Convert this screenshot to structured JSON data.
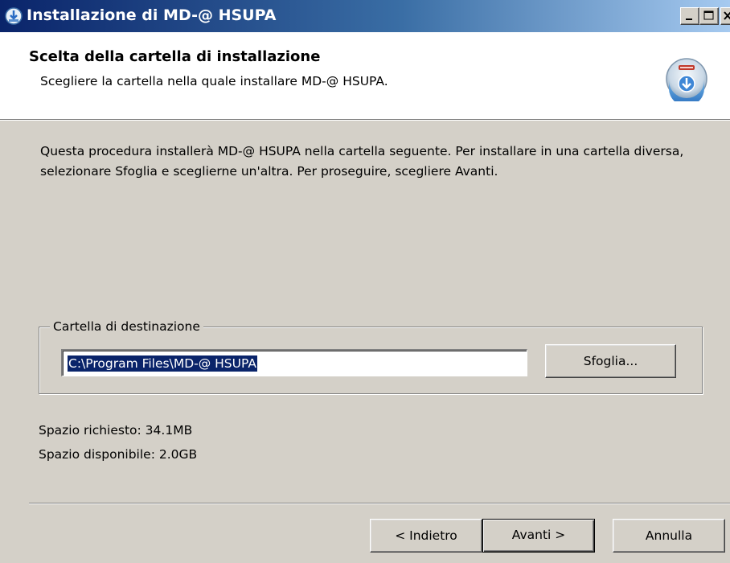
{
  "window": {
    "title": "Installazione di MD-@ HSUPA",
    "controls": {
      "minimize": "minimize",
      "maximize": "maximize",
      "close": "close"
    }
  },
  "header": {
    "title": "Scelta della cartella di installazione",
    "subtitle": "Scegliere la cartella nella quale installare MD-@ HSUPA.",
    "logo_icon": "installer-disc-icon"
  },
  "body": {
    "description": "Questa procedura installerà MD-@ HSUPA nella cartella seguente. Per installare in una cartella diversa, selezionare Sfoglia e sceglierne un'altra. Per proseguire, scegliere Avanti.",
    "destination": {
      "group_label": "Cartella di destinazione",
      "path_value": "C:\\Program Files\\MD-@ HSUPA",
      "browse_label": "Sfoglia..."
    },
    "space_required": "Spazio richiesto: 34.1MB",
    "space_available": "Spazio disponibile: 2.0GB"
  },
  "footer": {
    "back_label": "< Indietro",
    "next_label": "Avanti >",
    "cancel_label": "Annulla"
  },
  "colors": {
    "titlebar_start": "#0a246a",
    "titlebar_end": "#a6caf0",
    "face": "#d4d0c8",
    "selection": "#0a246a"
  }
}
